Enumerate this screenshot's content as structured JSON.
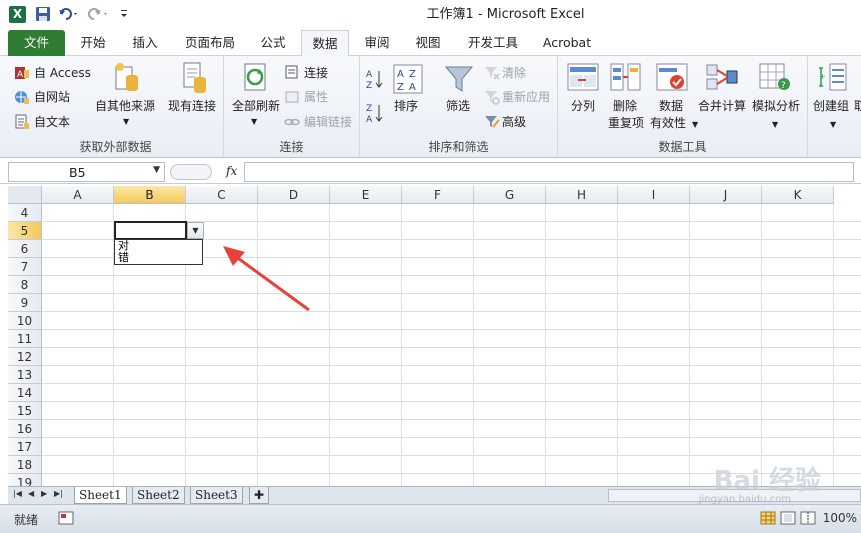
{
  "window": {
    "title": "工作簿1 - Microsoft Excel",
    "logo": "X"
  },
  "tabs": [
    {
      "label": "文件"
    },
    {
      "label": "开始"
    },
    {
      "label": "插入"
    },
    {
      "label": "页面布局"
    },
    {
      "label": "公式"
    },
    {
      "label": "数据"
    },
    {
      "label": "审阅"
    },
    {
      "label": "视图"
    },
    {
      "label": "开发工具"
    },
    {
      "label": "Acrobat"
    }
  ],
  "ribbon": {
    "external": {
      "label": "获取外部数据",
      "access": "自 Access",
      "web": "自网站",
      "text": "自文本",
      "other": "自其他来源",
      "existing": "现有连接"
    },
    "connections": {
      "label": "连接",
      "refresh": "全部刷新",
      "conn": "连接",
      "props": "属性",
      "edit_links": "编辑链接"
    },
    "sortfilter": {
      "label": "排序和筛选",
      "sort": "排序",
      "filter": "筛选",
      "clear": "清除",
      "reapply": "重新应用",
      "advanced": "高级"
    },
    "datatools": {
      "label": "数据工具",
      "split": "分列",
      "remove_dup_1": "删除",
      "remove_dup_2": "重复项",
      "validation_1": "数据",
      "validation_2": "有效性",
      "consolidate": "合并计算",
      "whatif": "模拟分析"
    },
    "outline": {
      "group": "创建组",
      "ungroup_partial": "取"
    }
  },
  "formula_bar": {
    "name_box": "B5",
    "fx": "fx",
    "value": ""
  },
  "grid": {
    "columns": [
      "A",
      "B",
      "C",
      "D",
      "E",
      "F",
      "G",
      "H",
      "I",
      "J",
      "K"
    ],
    "selected_column": "B",
    "rows": [
      "4",
      "5",
      "6",
      "7",
      "8",
      "9",
      "10",
      "11",
      "12",
      "13",
      "14",
      "15",
      "16",
      "17",
      "18",
      "19"
    ],
    "selected_row": "5",
    "dropdown_options": [
      "对",
      "错"
    ]
  },
  "sheets": [
    {
      "label": "Sheet1",
      "active": true
    },
    {
      "label": "Sheet2"
    },
    {
      "label": "Sheet3"
    }
  ],
  "status": {
    "ready": "就绪",
    "zoom": "100%"
  },
  "watermark": {
    "brand": "Bai 经验",
    "url": "jingyan.baidu.com"
  },
  "colors": {
    "file_tab": "#2e7d32",
    "arrow": "#e8403a",
    "selected_header": "#f5c85a"
  }
}
